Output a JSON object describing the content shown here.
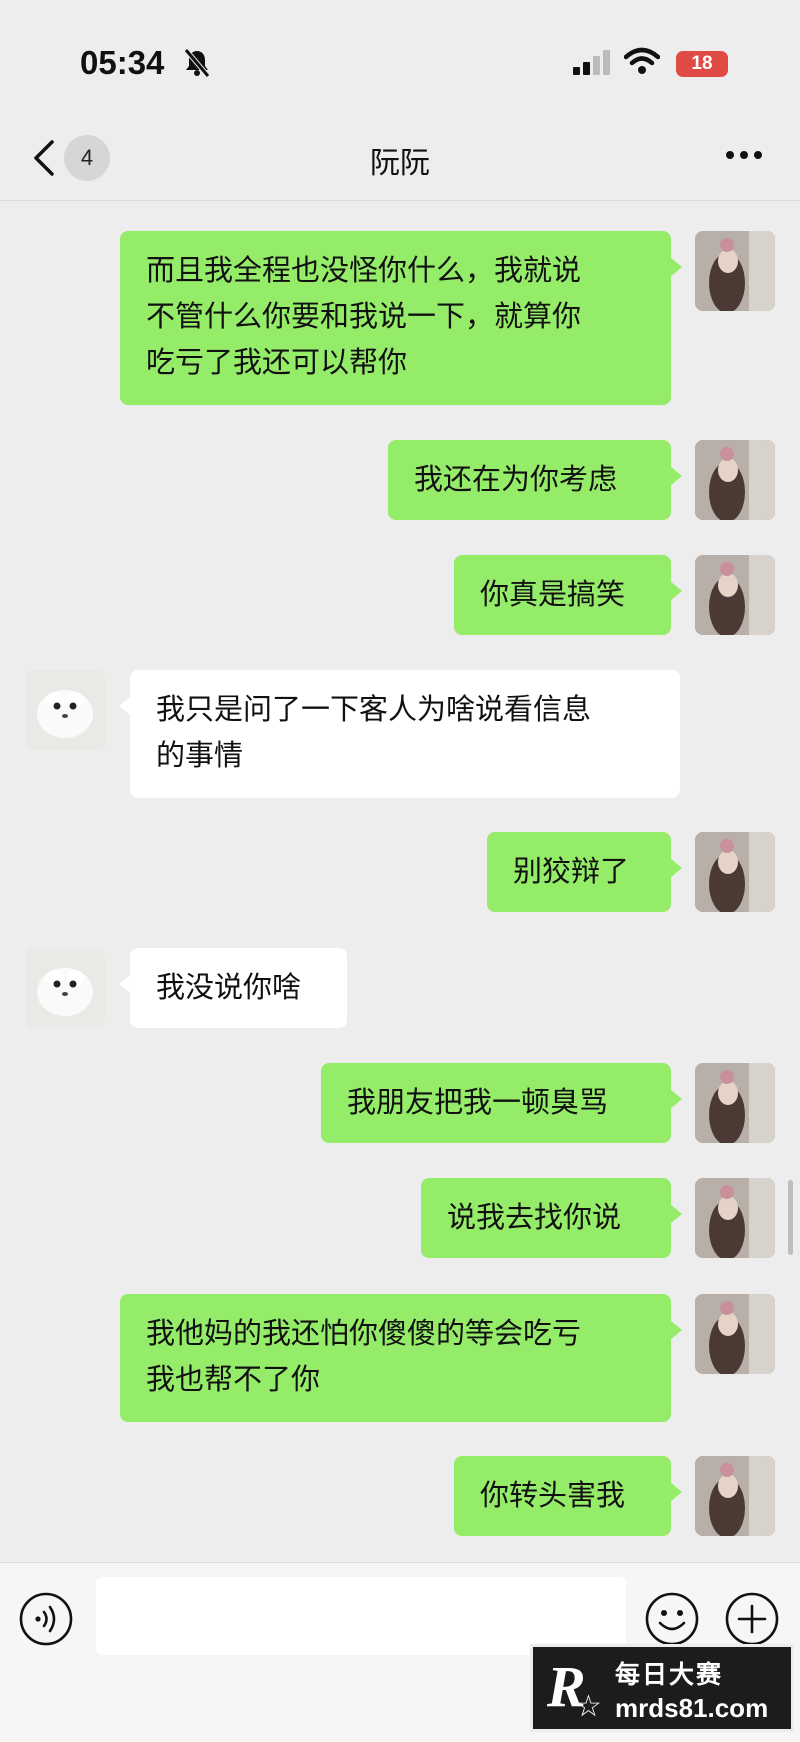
{
  "status_bar": {
    "time": "05:34",
    "battery": "18"
  },
  "header": {
    "unread_count": "4",
    "title": "阮阮"
  },
  "messages": [
    {
      "sender": "self",
      "text": "而且我全程也没怪你什么，我就说\n不管什么你要和我说一下，就算你\n吃亏了我还可以帮你"
    },
    {
      "sender": "self",
      "text": "我还在为你考虑"
    },
    {
      "sender": "self",
      "text": "你真是搞笑"
    },
    {
      "sender": "other",
      "text": "我只是问了一下客人为啥说看信息\n的事情"
    },
    {
      "sender": "self",
      "text": "别狡辩了"
    },
    {
      "sender": "other",
      "text": "我没说你啥"
    },
    {
      "sender": "self",
      "text": "我朋友把我一顿臭骂"
    },
    {
      "sender": "self",
      "text": "说我去找你说"
    },
    {
      "sender": "self",
      "text": "我他妈的我还怕你傻傻的等会吃亏\n我也帮不了你"
    },
    {
      "sender": "self",
      "text": "你转头害我"
    }
  ],
  "input_bar": {
    "value": ""
  },
  "watermark": {
    "logo": "R",
    "name": "每日大赛",
    "url": "mrds81.com"
  },
  "colors": {
    "outgoing_bubble": "#95ec69",
    "incoming_bubble": "#ffffff",
    "background": "#ededed"
  }
}
